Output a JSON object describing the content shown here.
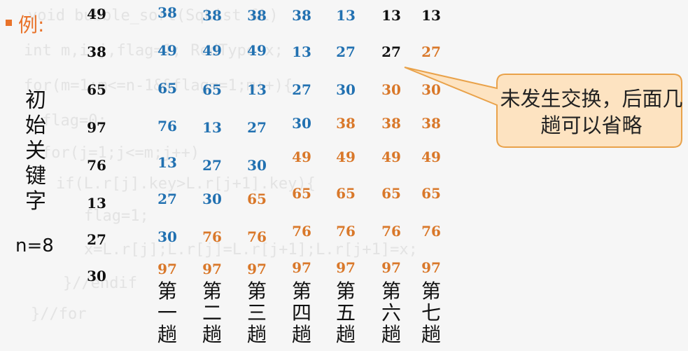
{
  "title": "例:",
  "initial_label": "初始关键字",
  "n_label": "n=8",
  "initial_keys": [
    "49",
    "38",
    "65",
    "97",
    "76",
    "13",
    "27",
    "30"
  ],
  "passes": [
    {
      "label": "第一趟",
      "values": [
        "38",
        "49",
        "65",
        "76",
        "13",
        "27",
        "30",
        "97"
      ],
      "colors": [
        "b",
        "b",
        "b",
        "b",
        "b",
        "b",
        "b",
        "o"
      ]
    },
    {
      "label": "第二趟",
      "values": [
        "38",
        "49",
        "65",
        "13",
        "27",
        "30",
        "76",
        "97"
      ],
      "colors": [
        "b",
        "b",
        "b",
        "b",
        "b",
        "b",
        "o",
        "o"
      ]
    },
    {
      "label": "第三趟",
      "values": [
        "38",
        "49",
        "13",
        "27",
        "30",
        "65",
        "76",
        "97"
      ],
      "colors": [
        "b",
        "b",
        "b",
        "b",
        "b",
        "o",
        "o",
        "o"
      ]
    },
    {
      "label": "第四趟",
      "values": [
        "38",
        "13",
        "27",
        "30",
        "49",
        "65",
        "76",
        "97"
      ],
      "colors": [
        "b",
        "b",
        "b",
        "b",
        "o",
        "o",
        "o",
        "o"
      ]
    },
    {
      "label": "第五趟",
      "values": [
        "13",
        "27",
        "30",
        "38",
        "49",
        "65",
        "76",
        "97"
      ],
      "colors": [
        "b",
        "b",
        "b",
        "o",
        "o",
        "o",
        "o",
        "o"
      ]
    },
    {
      "label": "第六趟",
      "values": [
        "13",
        "27",
        "30",
        "38",
        "49",
        "65",
        "76",
        "97"
      ],
      "colors": [
        "k",
        "k",
        "o",
        "o",
        "o",
        "o",
        "o",
        "o"
      ]
    },
    {
      "label": "第七趟",
      "values": [
        "13",
        "27",
        "30",
        "38",
        "49",
        "65",
        "76",
        "97"
      ],
      "colors": [
        "k",
        "o",
        "o",
        "o",
        "o",
        "o",
        "o",
        "o"
      ]
    }
  ],
  "callout": "未发生交换，后面几趟可以省略",
  "colors": {
    "black": "#111111",
    "blue": "#2271b1",
    "orange": "#d9782a",
    "accent": "#e9732a"
  }
}
